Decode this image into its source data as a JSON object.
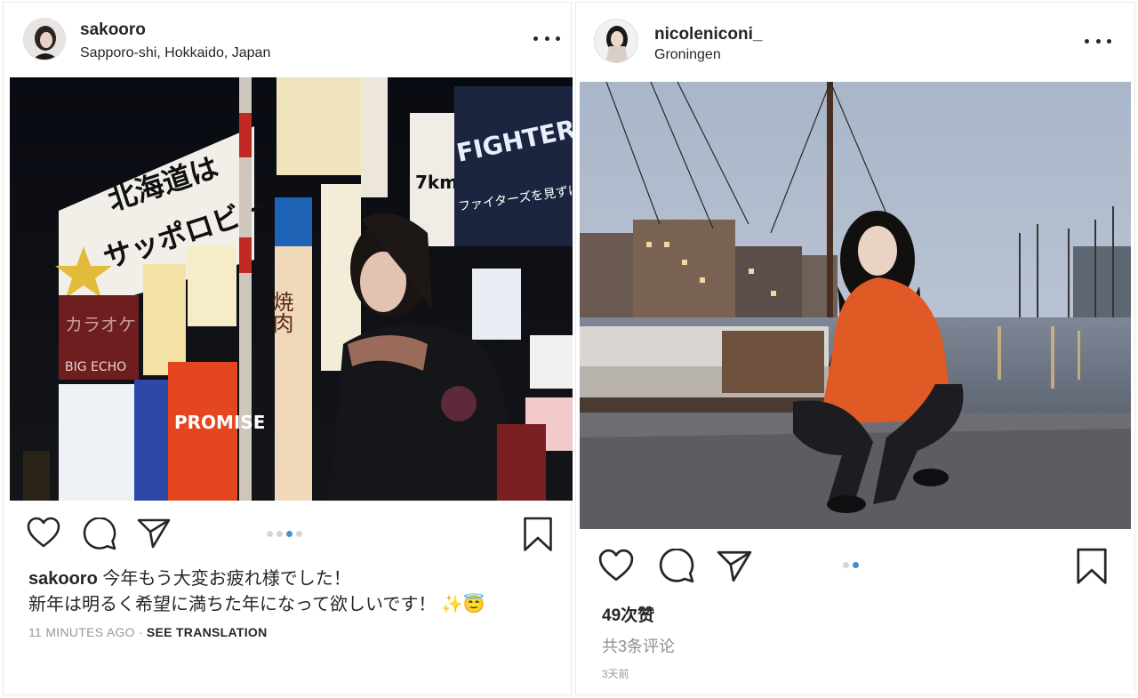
{
  "left_post": {
    "username": "sakooro",
    "location": "Sapporo-shi, Hokkaido, Japan",
    "photo_signs": {
      "billboard_line1": "北海道は",
      "billboard_line2": "サッポロビー",
      "karaoke": "カラオケ",
      "bigecho": "BIG ECHO",
      "vertical_sign": "焼肉",
      "promise": "PROMISE",
      "fighters": "FIGHTERS",
      "fighters_sub": "ファイターズを見ずに",
      "distance": "7km"
    },
    "carousel": {
      "count": 4,
      "active_index": 2
    },
    "caption_user": "sakooro",
    "caption_line1": "今年もう大変お疲れ様でした！",
    "caption_line2": "新年は明るく希望に満ちた年になって欲しいです！ ✨😇",
    "time_ago": "11 MINUTES AGO",
    "separator": "·",
    "see_translation": "SEE TRANSLATION"
  },
  "right_post": {
    "username": "nicoleniconi_",
    "location": "Groningen",
    "carousel": {
      "count": 2,
      "active_index": 1
    },
    "likes": "49次赞",
    "comments": "共3条评论",
    "time_ago": "3天前"
  },
  "icons": {
    "like": "heart-icon",
    "comment": "comment-bubble-icon",
    "share": "paper-plane-icon",
    "save": "bookmark-icon",
    "more": "more-dots-icon"
  },
  "colors": {
    "text": "#262626",
    "muted": "#999999",
    "carousel_active": "#3d91d9",
    "carousel_inactive": "#d4d4d4"
  }
}
